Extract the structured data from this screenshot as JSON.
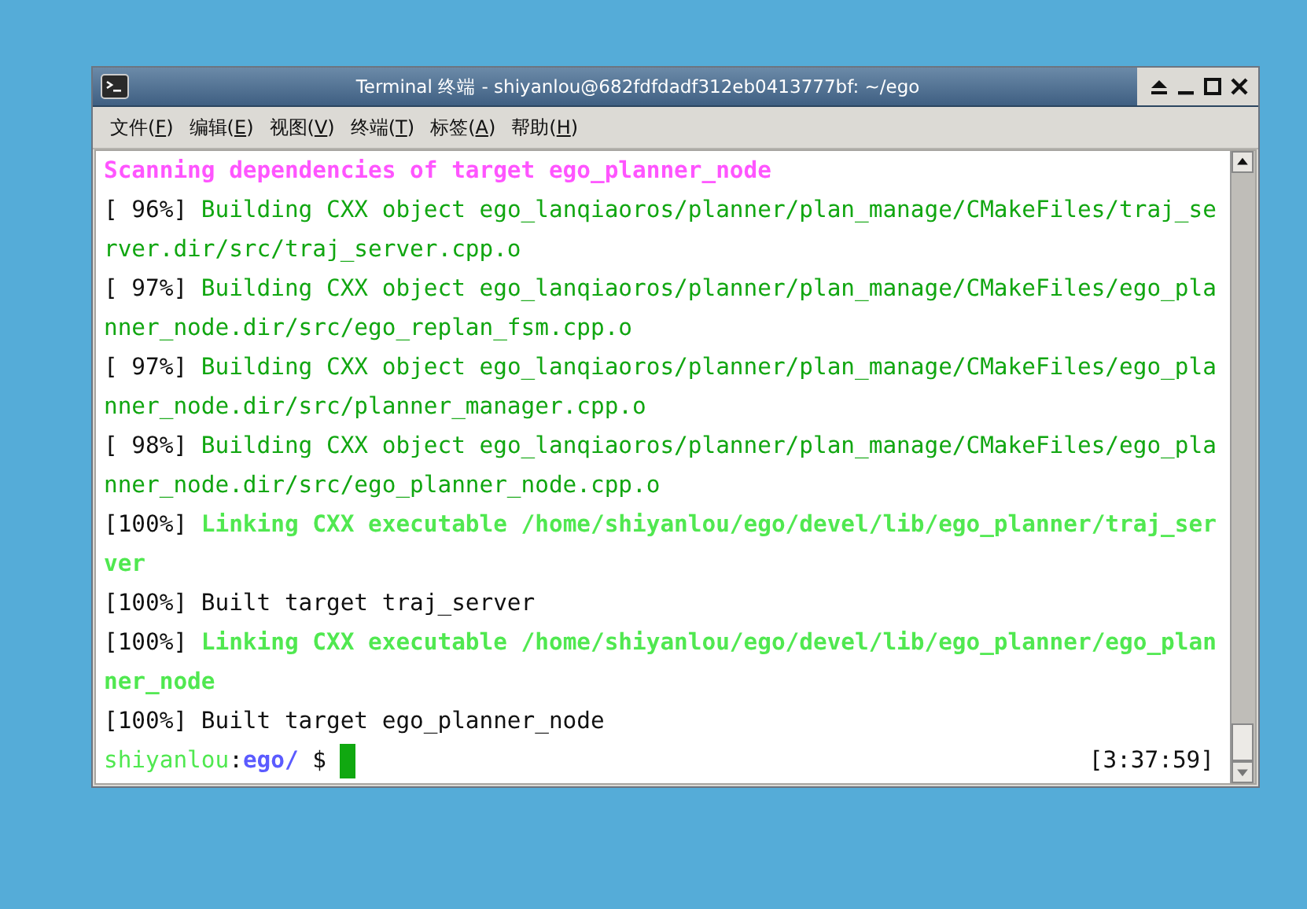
{
  "window": {
    "title": "Terminal 终端 - shiyanlou@682fdfdadf312eb0413777bf: ~/ego"
  },
  "menu": [
    {
      "label": "文件(",
      "key": "F",
      "end": ")"
    },
    {
      "label": "编辑(",
      "key": "E",
      "end": ")"
    },
    {
      "label": "视图(",
      "key": "V",
      "end": ")"
    },
    {
      "label": "终端(",
      "key": "T",
      "end": ")"
    },
    {
      "label": "标签(",
      "key": "A",
      "end": ")"
    },
    {
      "label": "帮助(",
      "key": "H",
      "end": ")"
    }
  ],
  "terminal": {
    "lines": [
      [
        {
          "text": "Scanning dependencies of target ego_planner_node",
          "kind": "scan"
        }
      ],
      [
        {
          "text": "[ 96%] ",
          "kind": "plain"
        },
        {
          "text": "Building CXX object ego_lanqiaoros/planner/plan_manage/CMakeFiles/traj_se",
          "kind": "build"
        }
      ],
      [
        {
          "text": "rver.dir/src/traj_server.cpp.o",
          "kind": "build"
        }
      ],
      [
        {
          "text": "[ 97%] ",
          "kind": "plain"
        },
        {
          "text": "Building CXX object ego_lanqiaoros/planner/plan_manage/CMakeFiles/ego_pla",
          "kind": "build"
        }
      ],
      [
        {
          "text": "nner_node.dir/src/ego_replan_fsm.cpp.o",
          "kind": "build"
        }
      ],
      [
        {
          "text": "[ 97%] ",
          "kind": "plain"
        },
        {
          "text": "Building CXX object ego_lanqiaoros/planner/plan_manage/CMakeFiles/ego_pla",
          "kind": "build"
        }
      ],
      [
        {
          "text": "nner_node.dir/src/planner_manager.cpp.o",
          "kind": "build"
        }
      ],
      [
        {
          "text": "[ 98%] ",
          "kind": "plain"
        },
        {
          "text": "Building CXX object ego_lanqiaoros/planner/plan_manage/CMakeFiles/ego_pla",
          "kind": "build"
        }
      ],
      [
        {
          "text": "nner_node.dir/src/ego_planner_node.cpp.o",
          "kind": "build"
        }
      ],
      [
        {
          "text": "[100%] ",
          "kind": "plain"
        },
        {
          "text": "Linking CXX executable /home/shiyanlou/ego/devel/lib/ego_planner/traj_ser",
          "kind": "link"
        }
      ],
      [
        {
          "text": "ver",
          "kind": "link"
        }
      ],
      [
        {
          "text": "[100%] Built target traj_server",
          "kind": "plain"
        }
      ],
      [
        {
          "text": "[100%] ",
          "kind": "plain"
        },
        {
          "text": "Linking CXX executable /home/shiyanlou/ego/devel/lib/ego_planner/ego_plan",
          "kind": "link"
        }
      ],
      [
        {
          "text": "ner_node",
          "kind": "link"
        }
      ],
      [
        {
          "text": "[100%] Built target ego_planner_node",
          "kind": "plain"
        }
      ]
    ],
    "prompt": [
      {
        "text": "shiyanlou",
        "kind": "user"
      },
      {
        "text": ":",
        "kind": "plain"
      },
      {
        "text": "ego/",
        "kind": "dir"
      },
      {
        "text": " $ ",
        "kind": "plain"
      }
    ],
    "clock": "[3:37:59]"
  }
}
